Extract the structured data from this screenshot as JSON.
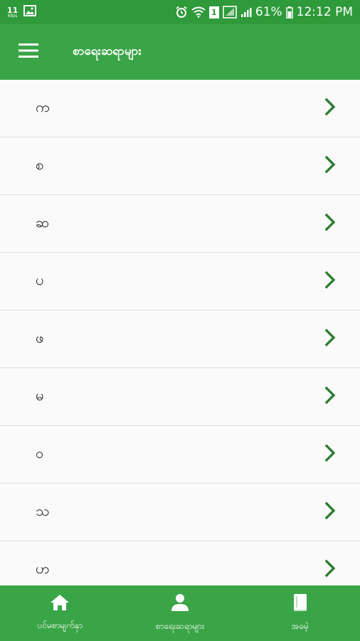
{
  "status_bar": {
    "net_speed": "11",
    "net_unit": "KB/s",
    "sim_indicator": "1",
    "battery": "61%",
    "time": "12:12 PM"
  },
  "app_bar": {
    "title": "စာရေးဆရာများ",
    "menu_icon": "hamburger-menu-icon"
  },
  "list": {
    "items": [
      {
        "label": "က"
      },
      {
        "label": "စ"
      },
      {
        "label": "ဆ"
      },
      {
        "label": "ပ"
      },
      {
        "label": "ဖ"
      },
      {
        "label": "မ"
      },
      {
        "label": "ဝ"
      },
      {
        "label": "သ"
      },
      {
        "label": "ဟ"
      }
    ]
  },
  "bottom_nav": {
    "tabs": [
      {
        "label": "ပင်မစာမျက်နှာ",
        "icon": "home-icon"
      },
      {
        "label": "စာရေးဆရာများ",
        "icon": "person-icon"
      },
      {
        "label": "အခမဲ့",
        "icon": "book-icon"
      }
    ]
  },
  "colors": {
    "status_bar": "#2e9a3a",
    "primary": "#3aa547",
    "chevron": "#2e7d32",
    "divider": "#dedede",
    "background": "#fafafa"
  }
}
